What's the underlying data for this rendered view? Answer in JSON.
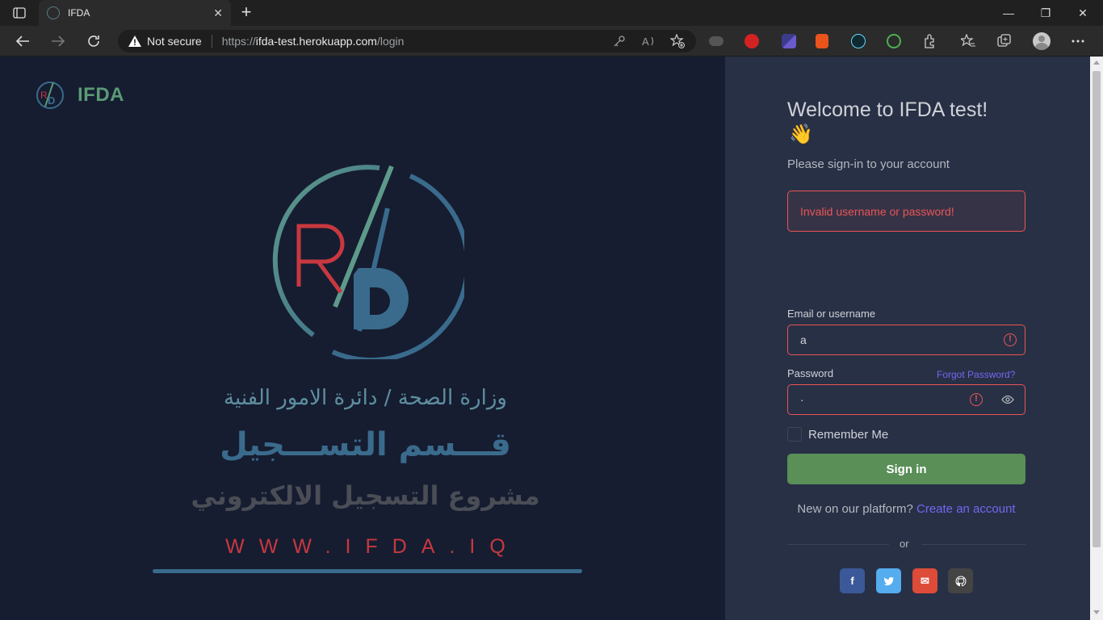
{
  "browser": {
    "tab_title": "IFDA",
    "close_glyph": "✕",
    "new_tab_glyph": "+",
    "security_label": "Not secure",
    "url_prefix": "https://",
    "url_host": "ifda-test.herokuapp.com",
    "url_path": "/login"
  },
  "window_controls": {
    "minimize": "—",
    "restore": "❐",
    "close": "✕"
  },
  "brand": {
    "name": "IFDA"
  },
  "hero": {
    "line1": "وزارة الصحة / دائرة الامور الفنية",
    "line2": "قـــسم التســـجيل",
    "line3": "مشروع التسجيل الالكتروني",
    "website": "WWW.IFDA.IQ"
  },
  "login": {
    "welcome": "Welcome to IFDA test!",
    "wave": "👋",
    "subtitle": "Please sign-in to your account",
    "alert": "Invalid username or password!",
    "email_label": "Email or username",
    "email_value": "a",
    "password_label": "Password",
    "forgot": "Forgot Password?",
    "password_value": "·",
    "error_glyph": "!",
    "remember": "Remember Me",
    "signin": "Sign in",
    "new_on_platform": "New on our platform?",
    "create_account": "Create an account",
    "or": "or"
  },
  "social": [
    {
      "name": "facebook",
      "glyph": "f",
      "color": "#3b5998"
    },
    {
      "name": "twitter",
      "glyph": "t",
      "color": "#55acee"
    },
    {
      "name": "email",
      "glyph": "✉",
      "color": "#dd4b39"
    },
    {
      "name": "github",
      "glyph": "g",
      "color": "#444444"
    }
  ],
  "colors": {
    "accent": "#7367f0",
    "danger": "#ea5455",
    "success": "#5a8f57",
    "panel_dark": "#161d31",
    "panel": "#283046"
  }
}
